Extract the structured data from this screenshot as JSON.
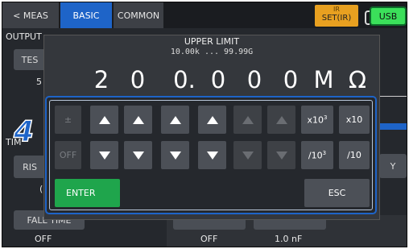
{
  "topbar": {
    "meas_label": "< MEAS",
    "basic_label": "BASIC",
    "common_label": "COMMON",
    "ir_label": "IR",
    "ir_setting": "SET(IR)",
    "usb_label": "USB"
  },
  "background": {
    "output_label": "OUTPUT",
    "test_label": "TES",
    "test_value": "5",
    "timer_label": "TIM",
    "rise_label": "RIS",
    "rise_value": "(",
    "fall_label": "FALL TIME",
    "fall_value": "OFF",
    "right_btn_label": "Y",
    "offset_value": "OFF",
    "capacitance_value": "1.0 nF"
  },
  "dialog": {
    "title": "UPPER LIMIT",
    "range": "10.00k ... 99.99G",
    "digits": [
      "2",
      "0",
      "0.",
      "0",
      "0",
      "0",
      "M",
      "Ω"
    ]
  },
  "keypad": {
    "plus_minus": "±",
    "off": "OFF",
    "x1000": "x10",
    "x1000_exp": "3",
    "x10": "x10",
    "div1000": "/10",
    "div1000_exp": "3",
    "div10": "/10",
    "enter": "ENTER",
    "esc": "ESC"
  },
  "step_number": "4",
  "colors": {
    "accent": "#1e64c8",
    "enter": "#1fa54c",
    "ir_badge": "#e8a020",
    "usb": "#3be05a"
  }
}
